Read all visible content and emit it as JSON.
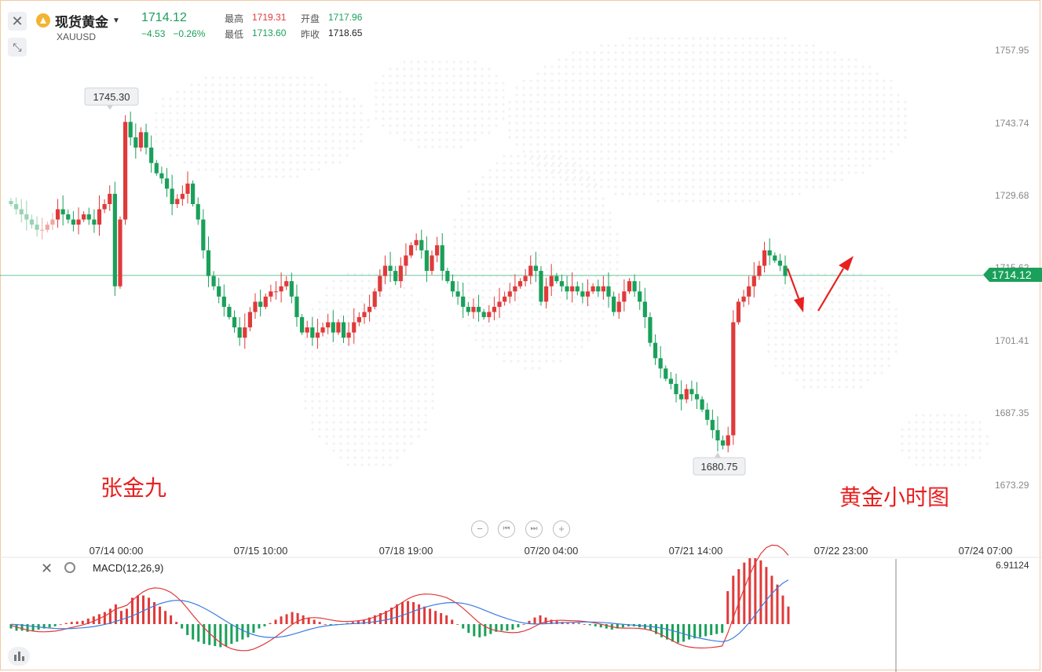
{
  "header": {
    "instrument_name": "现货黄金",
    "symbol": "XAUUSD",
    "last_price": "1714.12",
    "change": "−4.53",
    "change_pct": "−0.26%",
    "stats": {
      "high_label": "最高",
      "high": "1719.31",
      "open_label": "开盘",
      "open": "1717.96",
      "low_label": "最低",
      "low": "1713.60",
      "prev_close_label": "昨收",
      "prev_close": "1718.65"
    },
    "close_icon": "close-icon",
    "shrink_icon": "shrink-icon"
  },
  "annotations": {
    "author": "张金九",
    "caption": "黄金小时图",
    "high_marker": "1745.30",
    "low_marker": "1680.75",
    "price_tag": "1714.12"
  },
  "macd": {
    "label": "MACD(12,26,9)",
    "value": "6.91124"
  },
  "colors": {
    "up": "#e03a3a",
    "down": "#1aa05a",
    "dif_line": "#e03a3a",
    "dea_line": "#3b7ddd",
    "price_line": "#1aa05a"
  },
  "chart_data": [
    {
      "type": "candlestick",
      "title": "",
      "ylim": [
        1666,
        1765
      ],
      "y_ticks": [
        "1757.95",
        "1743.74",
        "1729.68",
        "1715.62",
        "1701.41",
        "1687.35",
        "1673.29"
      ],
      "x_ticks": [
        "07/14 00:00",
        "07/15 10:00",
        "07/18 19:00",
        "07/20 04:00",
        "07/21 14:00",
        "07/22 23:00",
        "07/24 07:00"
      ],
      "close_path": [
        1728,
        1727,
        1726,
        1725,
        1724,
        1723,
        1723,
        1724,
        1725,
        1727,
        1726,
        1725,
        1724,
        1725,
        1726,
        1725,
        1724,
        1727,
        1728,
        1730,
        1712,
        1725,
        1744,
        1741,
        1739,
        1742,
        1739,
        1736,
        1734,
        1733,
        1731,
        1728,
        1729,
        1730,
        1732,
        1728,
        1725,
        1719,
        1714,
        1712,
        1710,
        1708,
        1706,
        1704,
        1702,
        1704,
        1707,
        1709,
        1708,
        1710,
        1711,
        1711,
        1712,
        1713,
        1710,
        1706,
        1703,
        1704,
        1702,
        1703,
        1704,
        1705,
        1703,
        1705,
        1702,
        1703,
        1705,
        1706,
        1707,
        1708,
        1711,
        1714,
        1716,
        1715,
        1713,
        1716,
        1718,
        1720,
        1721,
        1719,
        1715,
        1718,
        1720,
        1715,
        1713,
        1711,
        1710,
        1708,
        1707,
        1708,
        1707,
        1706,
        1707,
        1708,
        1709,
        1710,
        1711,
        1712,
        1713,
        1714,
        1716,
        1715,
        1709,
        1712,
        1714,
        1713,
        1712,
        1711,
        1712,
        1711,
        1710,
        1711,
        1712,
        1711,
        1712,
        1710,
        1707,
        1709,
        1711,
        1713,
        1711,
        1709,
        1706,
        1701,
        1698,
        1696,
        1694,
        1693,
        1691,
        1690,
        1692,
        1691,
        1690,
        1688,
        1686,
        1684,
        1682,
        1681,
        1683,
        1705,
        1709,
        1710,
        1712,
        1714,
        1716,
        1719,
        1718,
        1717,
        1716,
        1714
      ]
    },
    {
      "type": "bar+line",
      "title": "MACD(12,26,9)",
      "series": [
        {
          "name": "MACD",
          "values": [
            -0.2,
            -0.3,
            -0.3,
            -0.35,
            -0.3,
            -0.25,
            -0.2,
            -0.15,
            -0.1,
            0.0,
            0.05,
            0.1,
            0.12,
            0.15,
            0.25,
            0.35,
            0.45,
            0.55,
            0.7,
            0.9,
            0.6,
            0.7,
            1.2,
            1.3,
            1.3,
            1.2,
            1.0,
            0.8,
            0.6,
            0.4,
            0.1,
            -0.2,
            -0.5,
            -0.7,
            -0.8,
            -0.9,
            -0.95,
            -1.0,
            -1.05,
            -1.0,
            -0.9,
            -0.8,
            -0.7,
            -0.6,
            -0.4,
            -0.2,
            -0.1,
            0.05,
            0.2,
            0.35,
            0.45,
            0.55,
            0.5,
            0.4,
            0.3,
            0.2,
            0.1,
            0.0,
            -0.05,
            -0.05,
            0.0,
            0.05,
            0.1,
            0.15,
            0.2,
            0.3,
            0.4,
            0.5,
            0.6,
            0.75,
            0.9,
            1.0,
            1.05,
            1.0,
            0.9,
            0.8,
            0.7,
            0.6,
            0.5,
            0.4,
            0.2,
            0.0,
            -0.2,
            -0.4,
            -0.55,
            -0.6,
            -0.55,
            -0.45,
            -0.35,
            -0.3,
            -0.3,
            -0.25,
            -0.15,
            0.0,
            0.15,
            0.3,
            0.4,
            0.3,
            0.2,
            0.15,
            0.1,
            0.05,
            0.05,
            0.05,
            0.0,
            -0.05,
            -0.1,
            -0.15,
            -0.2,
            -0.25,
            -0.2,
            -0.15,
            -0.1,
            -0.1,
            -0.15,
            -0.2,
            -0.3,
            -0.45,
            -0.6,
            -0.7,
            -0.8,
            -0.85,
            -0.8,
            -0.7,
            -0.65,
            -0.6,
            -0.55,
            -0.5,
            -0.45,
            -0.4,
            1.5,
            2.2,
            2.5,
            2.8,
            3.0,
            3.0,
            2.9,
            2.6,
            2.2,
            1.8,
            1.3,
            0.8
          ]
        }
      ]
    }
  ]
}
